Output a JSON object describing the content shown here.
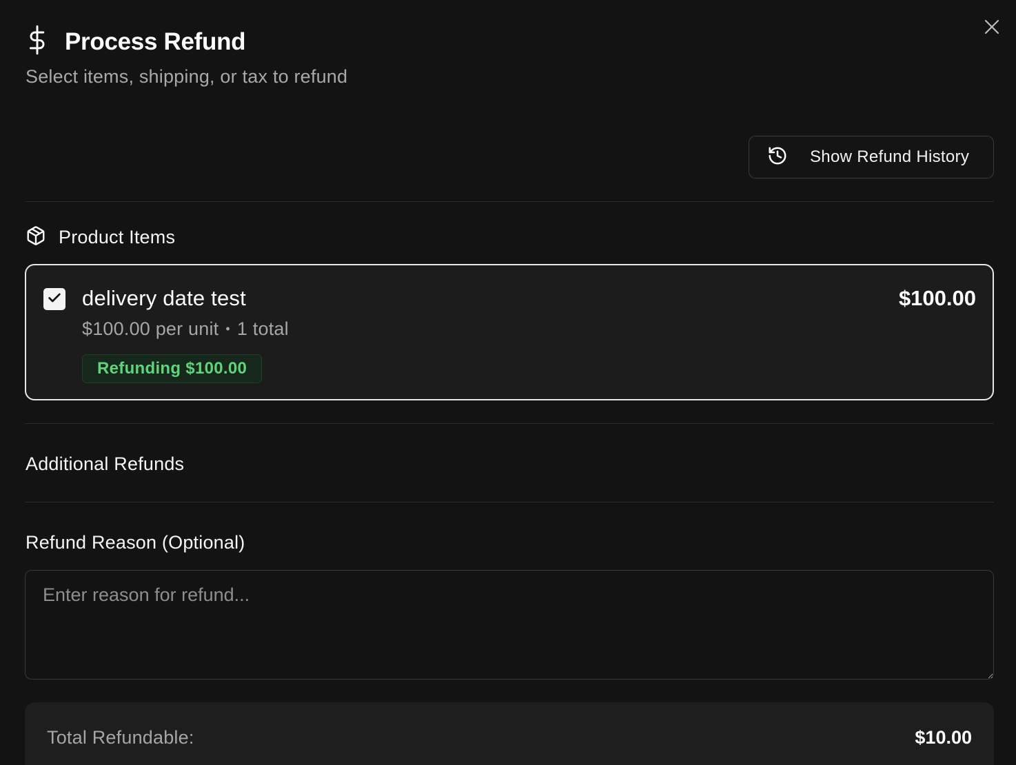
{
  "dialog": {
    "title": "Process Refund",
    "subtitle": "Select items, shipping, or tax to refund",
    "title_icon": "dollar-icon",
    "close_icon": "close-icon"
  },
  "toolbar": {
    "history_button_label": "Show Refund History",
    "history_icon": "history-icon"
  },
  "product_section": {
    "title": "Product Items",
    "icon": "package-icon",
    "items": [
      {
        "name": "delivery date test",
        "unit_price": "$100.00 per unit",
        "separator": "•",
        "quantity": "1 total",
        "price": "$100.00",
        "checked": true,
        "refund_badge": "Refunding $100.00"
      }
    ]
  },
  "additional_section": {
    "title": "Additional Refunds"
  },
  "reason": {
    "label": "Refund Reason (Optional)",
    "placeholder": "Enter reason for refund...",
    "value": ""
  },
  "summary": {
    "label": "Total Refundable:",
    "value": "$10.00"
  },
  "colors": {
    "background": "#131313",
    "card_border": "#e8e8e8",
    "badge_text": "#5fd47a",
    "badge_bg": "#16281b"
  }
}
